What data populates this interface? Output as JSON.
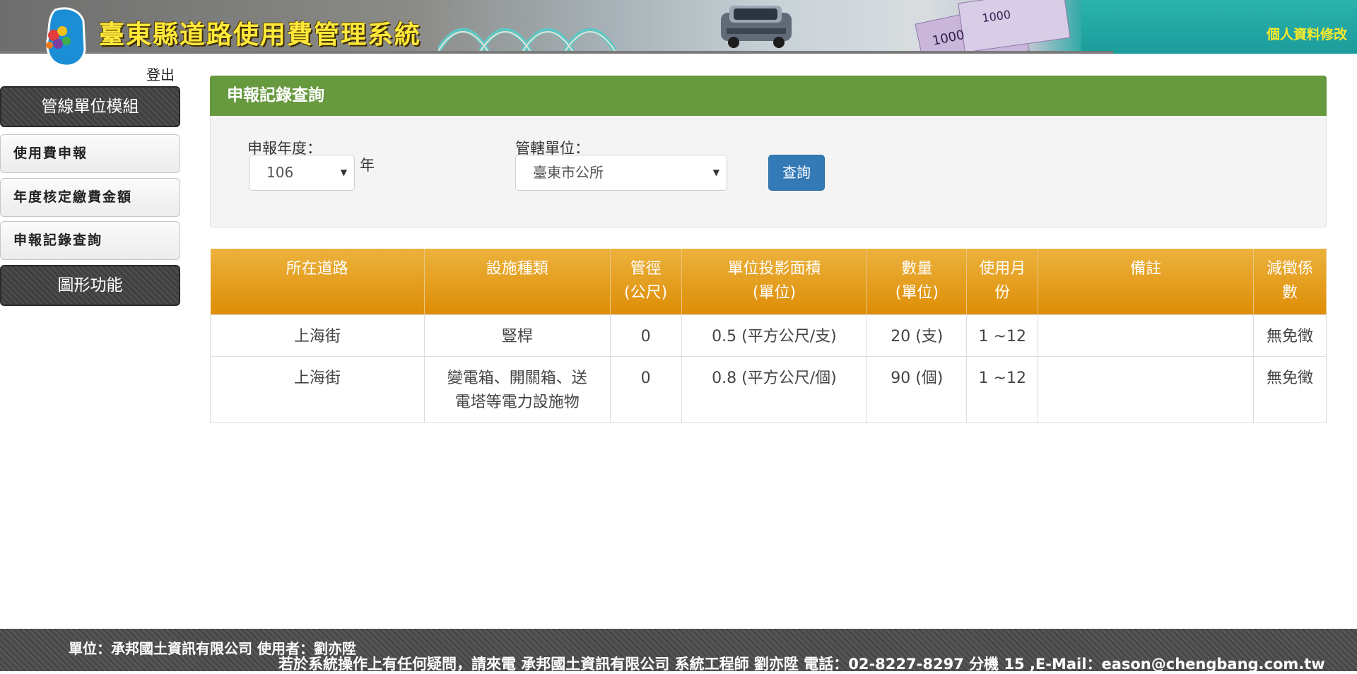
{
  "header": {
    "title": "臺東縣道路使用費管理系統",
    "profile_link": "個人資料修改"
  },
  "sidebar": {
    "logout": "登出",
    "items": [
      {
        "label": "管線單位模組"
      },
      {
        "label": "使用費申報"
      },
      {
        "label": "年度核定繳費金額"
      },
      {
        "label": "申報記錄查詢"
      },
      {
        "label": "圖形功能"
      }
    ]
  },
  "panel": {
    "title": "申報記錄查詢",
    "year_label": "申報年度：",
    "year_value": "106",
    "year_suffix": "年",
    "unit_label": "管轄單位：",
    "unit_value": "臺東市公所",
    "query_button": "查詢"
  },
  "table": {
    "headers": [
      [
        "所在道路"
      ],
      [
        "設施種類"
      ],
      [
        "管徑",
        "(公尺)"
      ],
      [
        "單位投影面積",
        "(單位)"
      ],
      [
        "數量",
        "(單位)"
      ],
      [
        "使用月",
        "份"
      ],
      [
        "備註"
      ],
      [
        "減徵係",
        "數"
      ]
    ],
    "rows": [
      {
        "road": "上海街",
        "facility": [
          "豎桿"
        ],
        "diameter": "0",
        "area": "0.5 (平方公尺/支)",
        "quantity": "20 (支)",
        "months": "1 ~12",
        "note": "",
        "reduction": "無免徵"
      },
      {
        "road": "上海街",
        "facility": [
          "變電箱、開關箱、送",
          "電塔等電力設施物"
        ],
        "diameter": "0",
        "area": "0.8 (平方公尺/個)",
        "quantity": "90 (個)",
        "months": "1 ~12",
        "note": "",
        "reduction": "無免徵"
      }
    ]
  },
  "footer": {
    "line1": "單位：承邦國土資訊有限公司 使用者：劉亦陞",
    "line2": "若於系統操作上有任何疑問，請來電 承邦國土資訊有限公司 系統工程師 劉亦陞 電話：02-8227-8297 分機 15 ,E-Mail：eason@chengbang.com.tw"
  },
  "colors": {
    "panel_header": "#67993f",
    "table_header": "#de8d06",
    "query_button": "#337ab7",
    "title_text": "#ffe93a"
  }
}
